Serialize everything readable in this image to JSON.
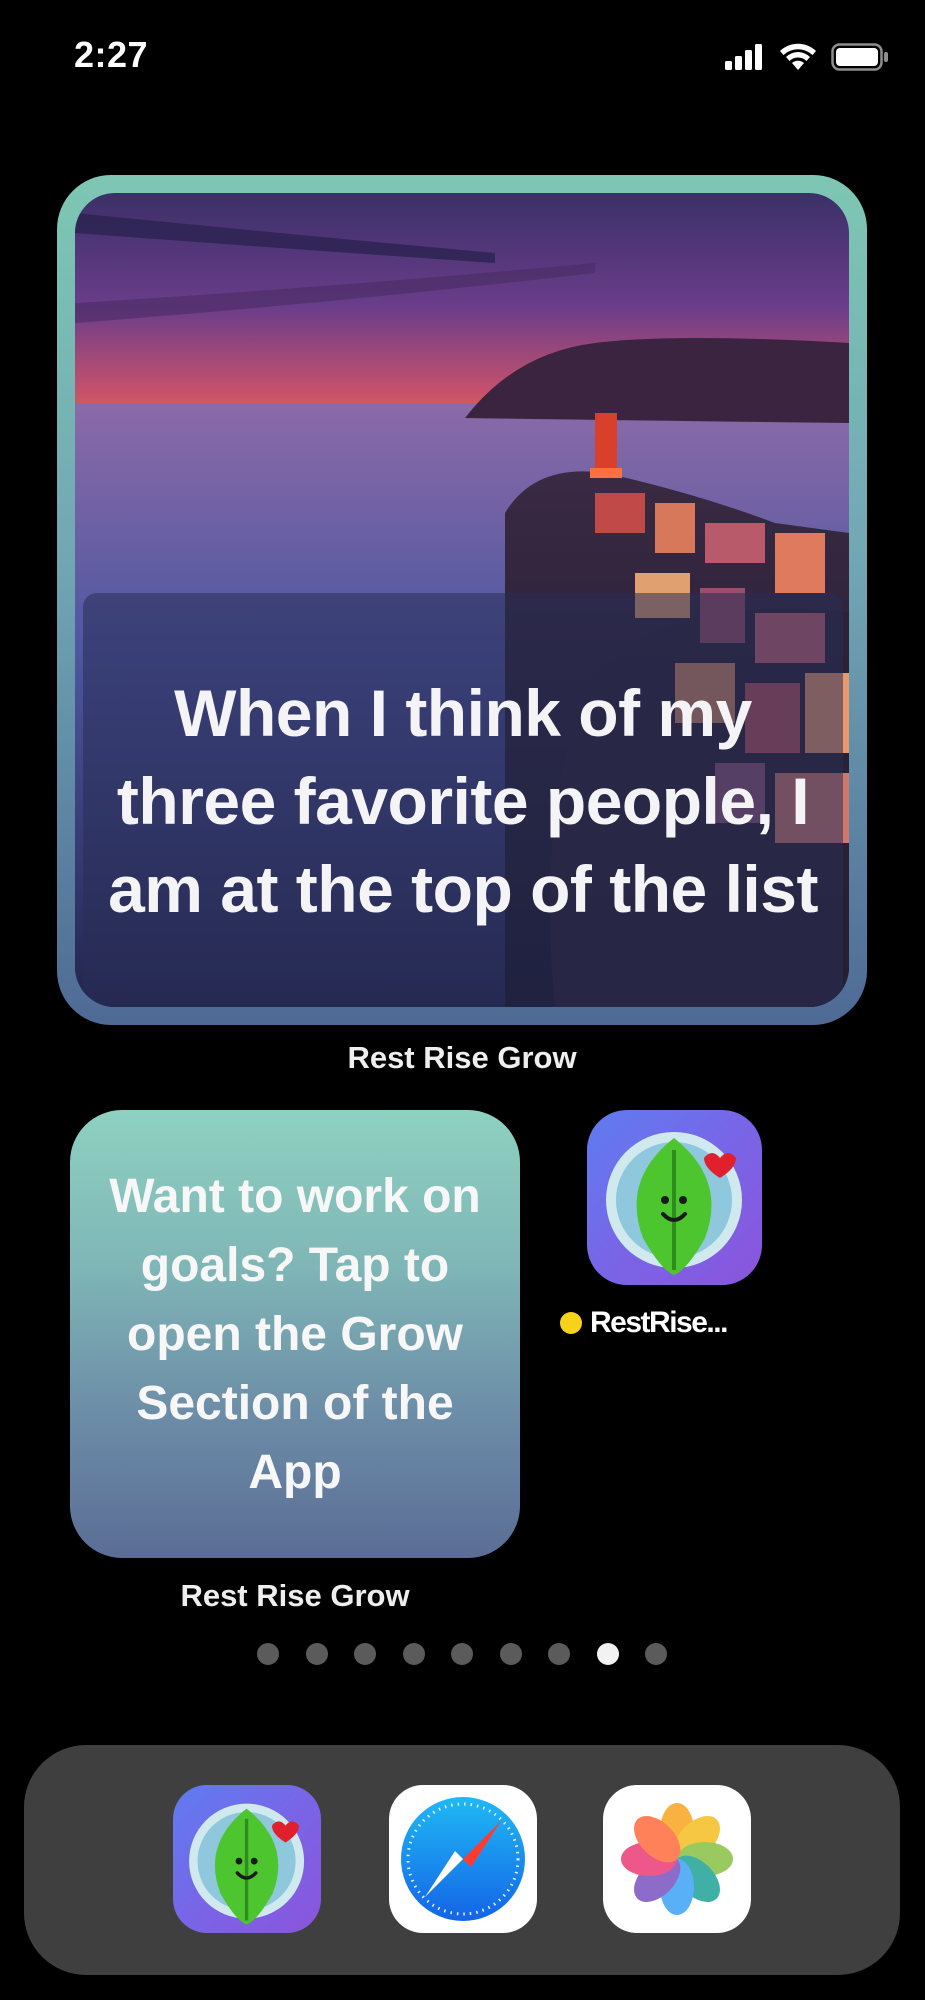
{
  "status_bar": {
    "time": "2:27",
    "icons": [
      "cellular-signal-icon",
      "wifi-icon",
      "battery-icon"
    ]
  },
  "quote_widget": {
    "quote": "When I think of my three favorite people, I am at the top of the list",
    "label": "Rest Rise Grow"
  },
  "goals_widget": {
    "text": "Want to work on goals? Tap to open the Grow Section of the App",
    "label": "Rest Rise Grow"
  },
  "app_icon": {
    "name": "RestRise...",
    "icon": "leaf-mascot-icon",
    "new_indicator_color": "#f6d21a"
  },
  "page_indicator": {
    "count": 9,
    "active_index": 7
  },
  "dock": {
    "apps": [
      {
        "icon": "leaf-mascot-icon"
      },
      {
        "icon": "safari-compass-icon"
      },
      {
        "icon": "photos-flower-icon"
      }
    ]
  },
  "colors": {
    "widget_accent": "#7ec7b3",
    "app_icon_accent": "#7b63e6"
  }
}
